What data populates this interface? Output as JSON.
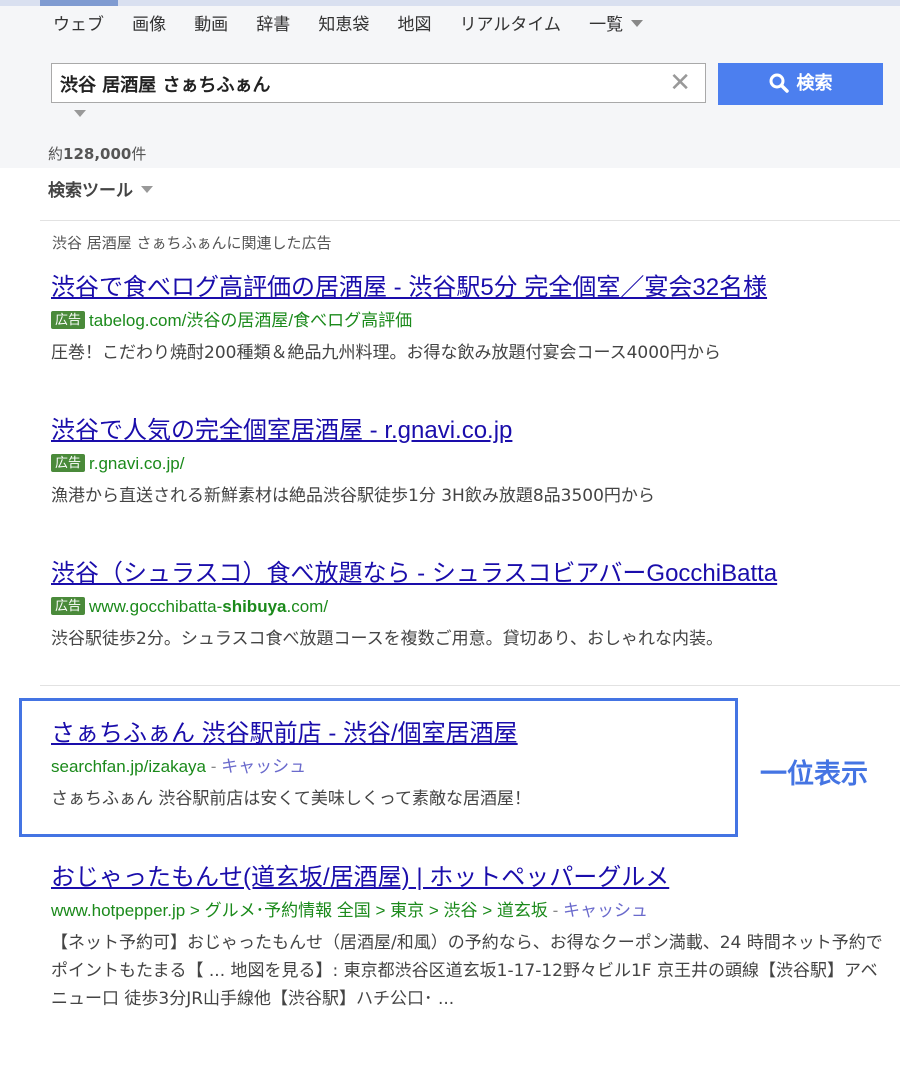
{
  "tabs": [
    {
      "label": "ウェブ"
    },
    {
      "label": "画像"
    },
    {
      "label": "動画"
    },
    {
      "label": "辞書"
    },
    {
      "label": "知恵袋"
    },
    {
      "label": "地図"
    },
    {
      "label": "リアルタイム"
    },
    {
      "label": "一覧"
    }
  ],
  "search": {
    "value": "渋谷 居酒屋 さぁちふぁん",
    "button_label": "検索"
  },
  "results_count": {
    "prefix": "約",
    "number": "128,000",
    "suffix": "件"
  },
  "search_tools_label": "検索ツール",
  "ads_label": "渋谷 居酒屋 さぁちふぁんに関連した広告",
  "ad_badge": "広告",
  "ads": [
    {
      "title": "渋谷で食べログ高評価の居酒屋 - 渋谷駅5分 完全個室／宴会32名様",
      "url": "tabelog.com/渋谷の居酒屋/食べログ高評価",
      "desc": "圧巻！こだわり焼酎200種類＆絶品九州料理。お得な飲み放題付宴会コース4000円から"
    },
    {
      "title": "渋谷で人気の完全個室居酒屋 - r.gnavi.co.jp",
      "url": "r.gnavi.co.jp/",
      "desc": "漁港から直送される新鮮素材は絶品渋谷駅徒歩1分 3H飲み放題8品3500円から"
    },
    {
      "title": "渋谷（シュラスコ）食べ放題なら - シュラスコビアバーGocchiBatta",
      "url_pre": "www.gocchibatta-",
      "url_bold": "shibuya",
      "url_post": ".com/",
      "desc": "渋谷駅徒歩2分。シュラスコ食べ放題コースを複数ご用意。貸切あり、おしゃれな内装。"
    }
  ],
  "organic": [
    {
      "title": "さぁちふぁん 渋谷駅前店 - 渋谷/個室居酒屋",
      "url": "searchfan.jp/izakaya",
      "separator": " - ",
      "cache": "キャッシュ",
      "desc": "さぁちふぁん 渋谷駅前店は安くて美味しくって素敵な居酒屋！"
    },
    {
      "title": "おじゃったもんせ(道玄坂/居酒屋) | ホットペッパーグルメ",
      "url": "www.hotpepper.jp > グルメ･予約情報 全国 > 東京 > 渋谷 > 道玄坂",
      "separator": " - ",
      "cache": "キャッシュ",
      "desc": "【ネット予約可】おじゃったもんせ（居酒屋/和風）の予約なら、お得なクーポン満載、24 時間ネット予約でポイントもたまる【 ... 地図を見る】: 東京都渋谷区道玄坂1-17-12野々ビル1F 京王井の頭線【渋谷駅】アベニュー口 徒歩3分JR山手線他【渋谷駅】ハチ公口･ ..."
    }
  ],
  "rank_annotation": "一位表示",
  "colors": {
    "link": "#1a0dab",
    "url": "#1b8a1b",
    "accent": "#4c7fef",
    "highlight": "#4474e3",
    "ad_badge": "#4a8a3a"
  }
}
